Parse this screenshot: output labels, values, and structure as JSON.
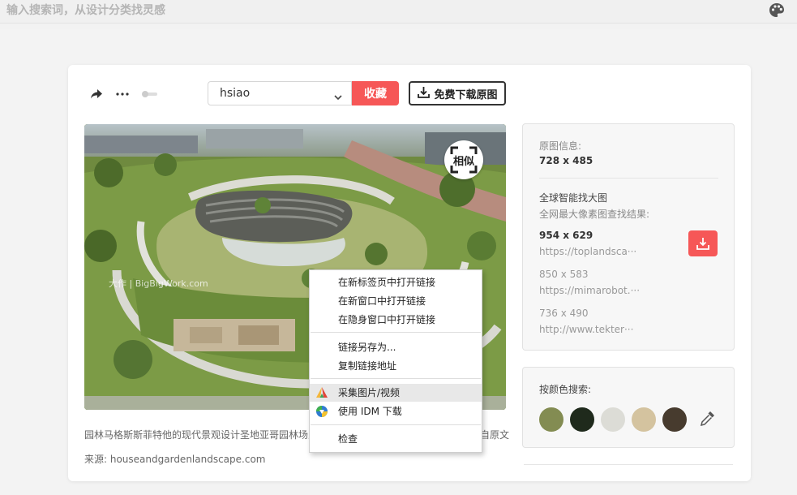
{
  "search": {
    "placeholder": "输入搜索词，从设计分类找灵感"
  },
  "icons": {
    "palette": "palette-icon",
    "share": "share-icon",
    "more": "more-icon",
    "toggle": "toggle-icon",
    "download": "download-icon",
    "similar": "scan-icon",
    "dropper": "eyedropper-icon"
  },
  "toolbar": {
    "board_select_value": "hsiao",
    "collect_label": "收藏",
    "free_download_label": "免费下载原图"
  },
  "image": {
    "watermark": "大作 | BigBigWork.com",
    "similar_label": "相似",
    "caption": "园林马格斯斯菲特他的现代景观设计圣地亚哥园林场之",
    "caption_tail": "自原文",
    "source": "来源: houseandgardenlandscape.com"
  },
  "info": {
    "original_label": "原图信息:",
    "original_size": "728 x 485",
    "global_title": "全球智能找大图",
    "global_sub": "全网最大像素图查找结果:",
    "results": [
      {
        "size": "954 x 629",
        "url": "https://toplandsca···"
      },
      {
        "size": "850 x 583",
        "url": "https://mimarobot.···"
      },
      {
        "size": "736 x 490",
        "url": "http://www.tekter···"
      }
    ]
  },
  "color_search": {
    "title": "按颜色搜索:",
    "swatches": [
      "#838c52",
      "#1f2a1c",
      "#dcdcd6",
      "#d4c39f",
      "#473b2e"
    ]
  },
  "context_menu": {
    "items": [
      "在新标签页中打开链接",
      "在新窗口中打开链接",
      "在隐身窗口中打开链接",
      "链接另存为...",
      "复制链接地址",
      "采集图片/视频",
      "使用 IDM 下载",
      "检查"
    ]
  }
}
